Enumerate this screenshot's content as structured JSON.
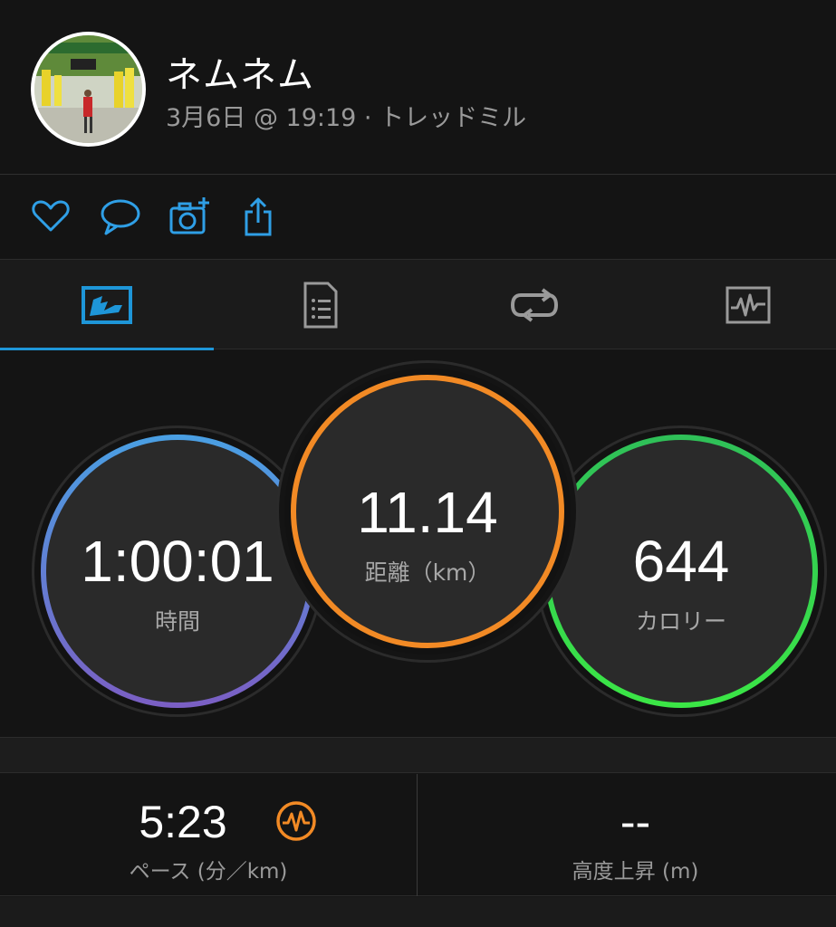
{
  "header": {
    "user_name": "ネムネム",
    "meta": "3月6日 @ 19:19 · トレッドミル"
  },
  "actions": {
    "icons": [
      "heart-icon",
      "comment-icon",
      "add-photo-icon",
      "share-icon"
    ]
  },
  "tabs": {
    "icons": [
      "overview-icon",
      "details-icon",
      "laps-icon",
      "chart-icon"
    ],
    "active_index": 0,
    "accent": "#1e96d8"
  },
  "stats": {
    "time": {
      "value": "1:00:01",
      "label": "時間"
    },
    "distance": {
      "value": "11.14",
      "label": "距離（km）"
    },
    "calories": {
      "value": "644",
      "label": "カロリー"
    }
  },
  "bottom": {
    "pace": {
      "value": "5:23",
      "label": "ペース (分／km)"
    },
    "elevation": {
      "value": "--",
      "label": "高度上昇 (m)"
    }
  },
  "colors": {
    "time_ring": [
      "#4a9fe3",
      "#7a5fc4"
    ],
    "distance_ring": "#f28a25",
    "calories_ring": [
      "#2fc058",
      "#3be646"
    ]
  }
}
